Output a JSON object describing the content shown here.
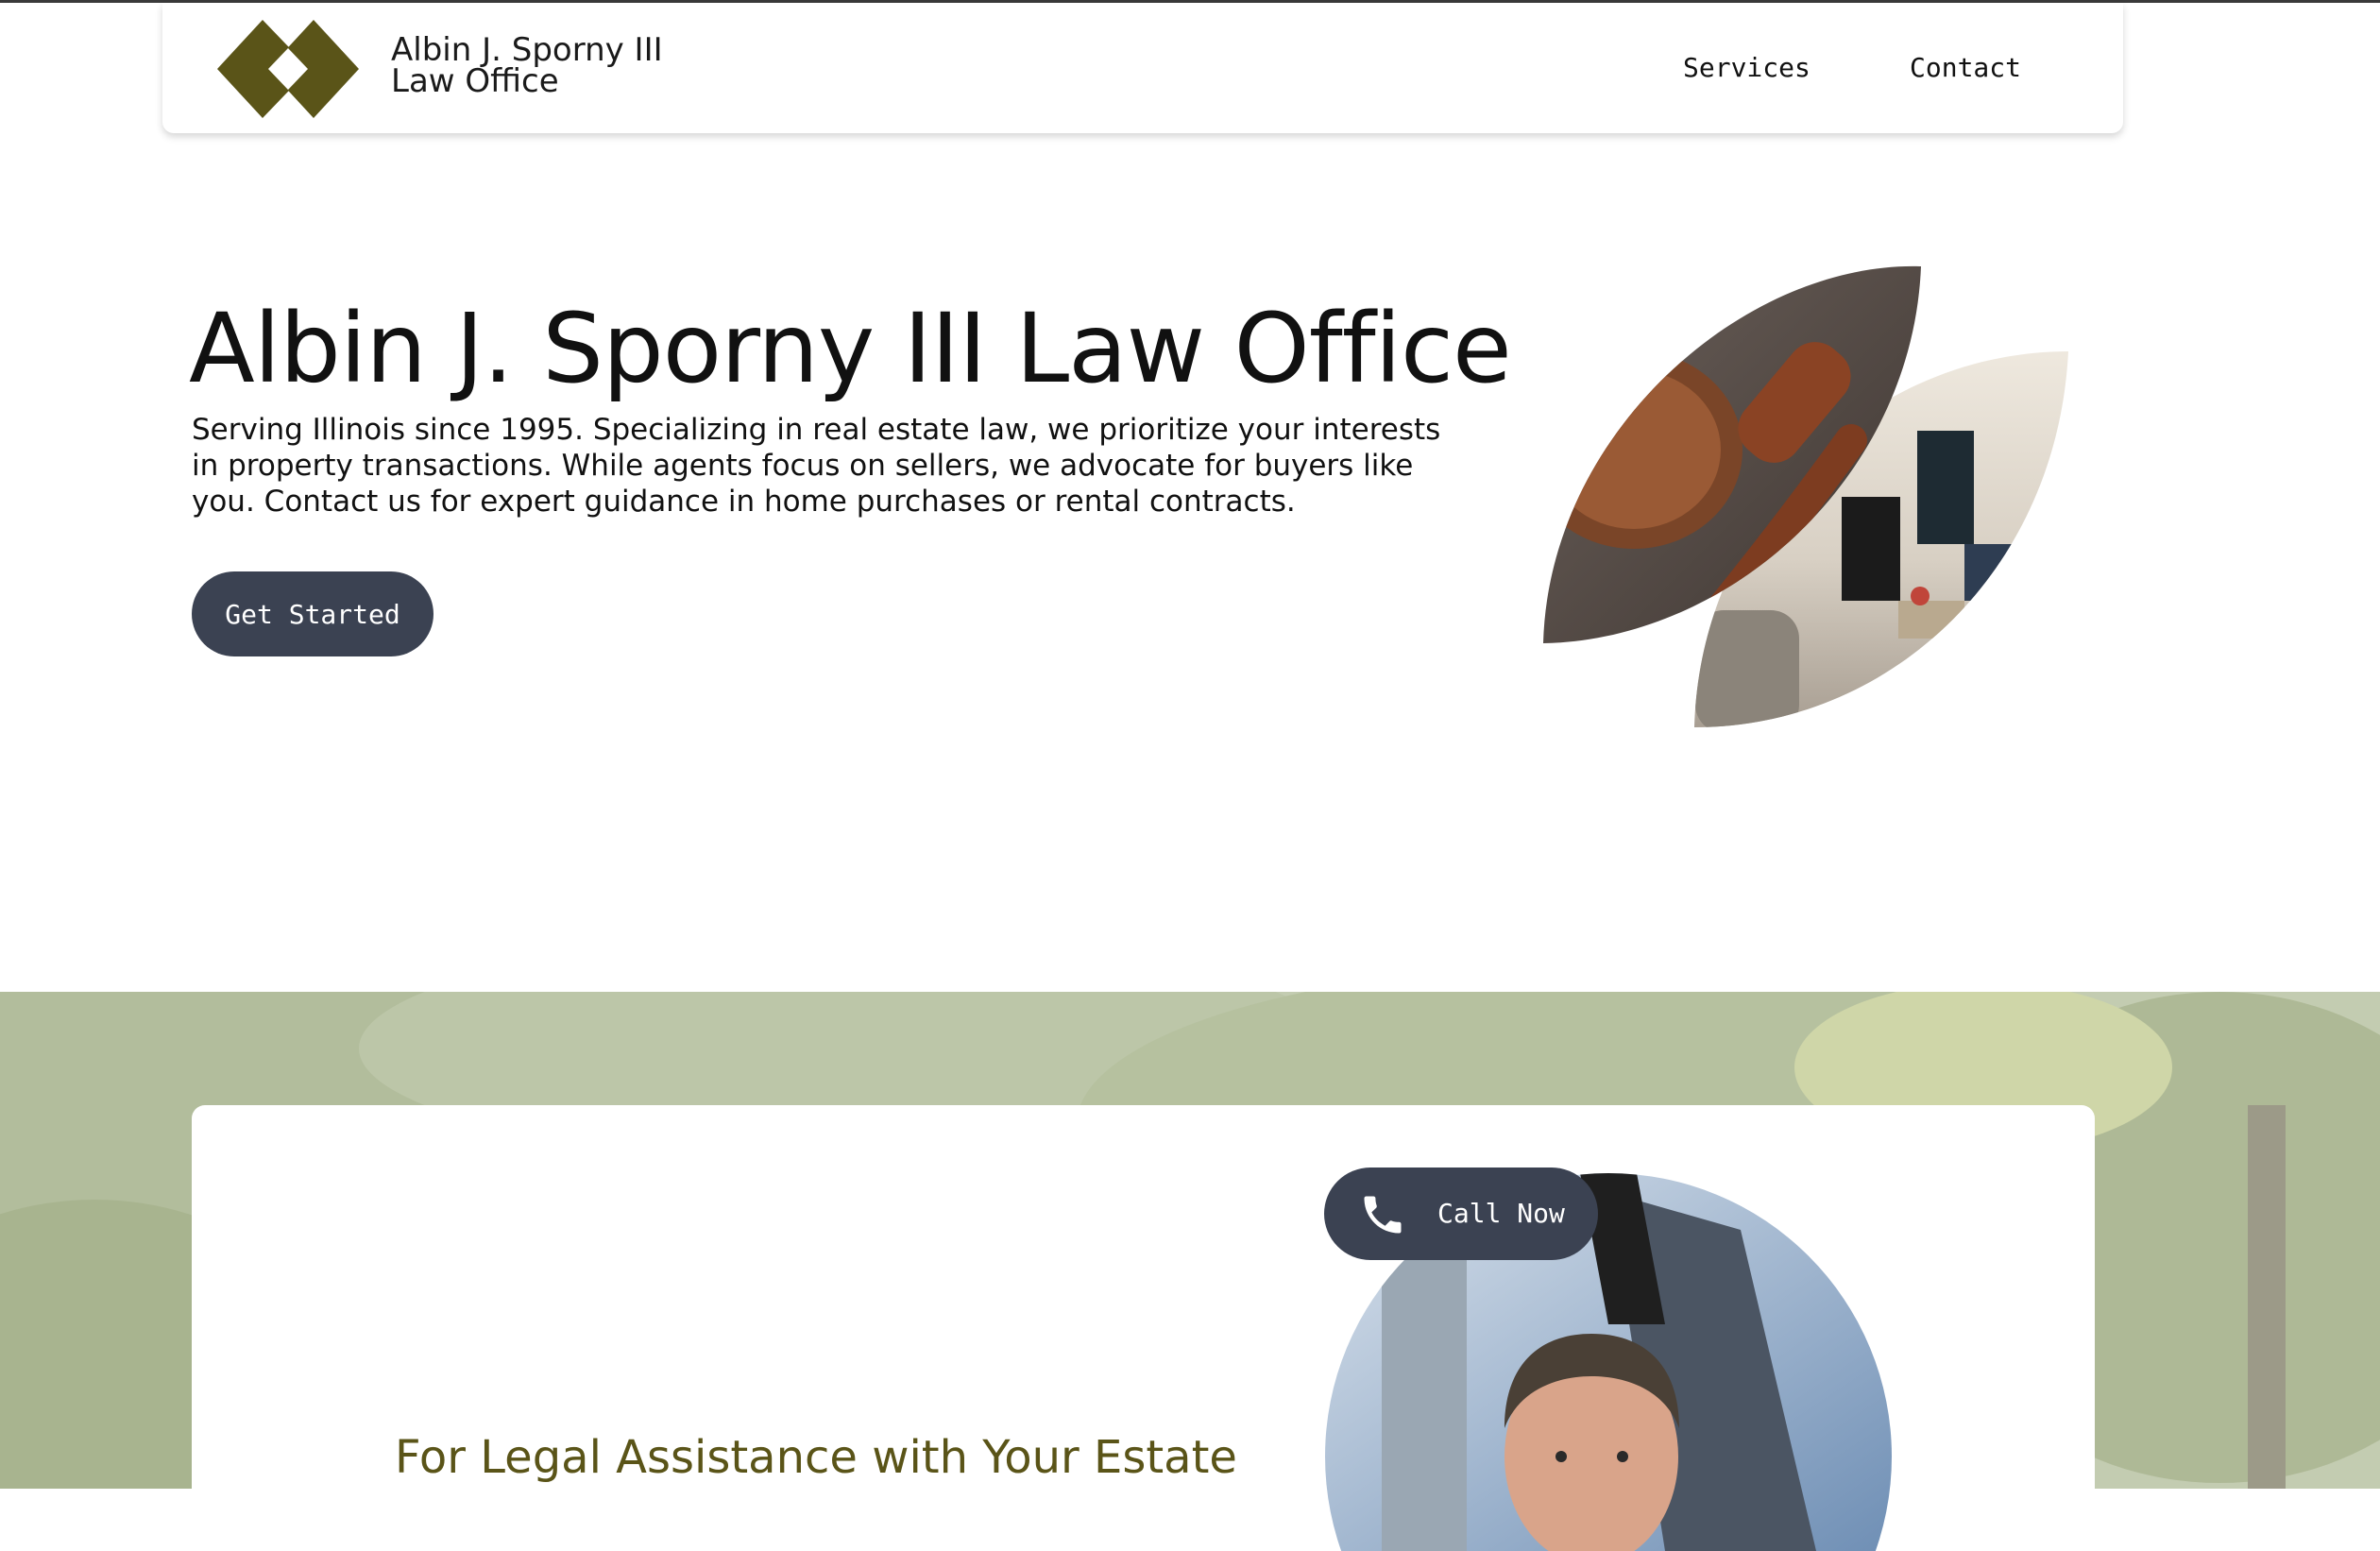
{
  "header": {
    "brand_line1": "Albin J. Sporny III",
    "brand_line2": "Law Office",
    "logo_icon": "double-diamond-logo-icon",
    "nav": {
      "services": "Services",
      "contact": "Contact"
    }
  },
  "hero": {
    "title": "Albin J. Sporny III Law Office",
    "description": "Serving Illinois since 1995. Specializing in real estate law, we prioritize your interests in property transactions. While agents focus on sellers, we advocate for buyers like you. Contact us for expert guidance in home purchases or rental contracts.",
    "cta_label": "Get Started"
  },
  "contact_section": {
    "call_label": "Call Now",
    "call_icon": "phone-icon",
    "heading": "For Legal Assistance with Your Estate"
  },
  "colors": {
    "brand_olive": "#5a5418",
    "button_dark": "#3b4252",
    "text": "#111111",
    "background": "#ffffff"
  }
}
